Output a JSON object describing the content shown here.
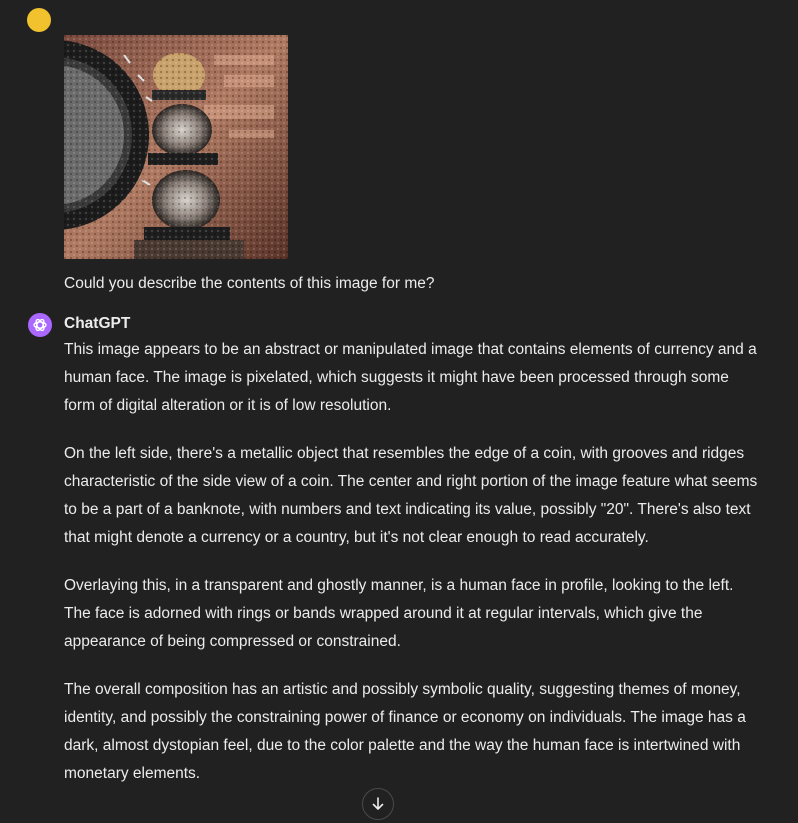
{
  "user_message": {
    "image_alt": "Uploaded image",
    "text": "Could you describe the contents of this image for me?"
  },
  "assistant_message": {
    "name": "ChatGPT",
    "paragraphs": [
      "This image appears to be an abstract or manipulated image that contains elements of currency and a human face. The image is pixelated, which suggests it might have been processed through some form of digital alteration or it is of low resolution.",
      "On the left side, there's a metallic object that resembles the edge of a coin, with grooves and ridges characteristic of the side view of a coin. The center and right portion of the image feature what seems to be a part of a banknote, with numbers and text indicating its value, possibly \"20\". There's also text that might denote a currency or a country, but it's not clear enough to read accurately.",
      "Overlaying this, in a transparent and ghostly manner, is a human face in profile, looking to the left. The face is adorned with rings or bands wrapped around it at regular intervals, which give the appearance of being compressed or constrained.",
      "The overall composition has an artistic and possibly symbolic quality, suggesting themes of money, identity, and possibly the constraining power of finance or economy on individuals. The image has a dark, almost dystopian feel, due to the color palette and the way the human face is intertwined with monetary elements."
    ]
  },
  "icons": {
    "user_avatar": "user-avatar-icon",
    "assistant_avatar": "openai-logo-icon",
    "scroll_down": "arrow-down-icon"
  },
  "colors": {
    "background": "#212121",
    "text": "#ececec",
    "user_avatar": "#f2c12e",
    "assistant_avatar": "#ab68ff"
  }
}
